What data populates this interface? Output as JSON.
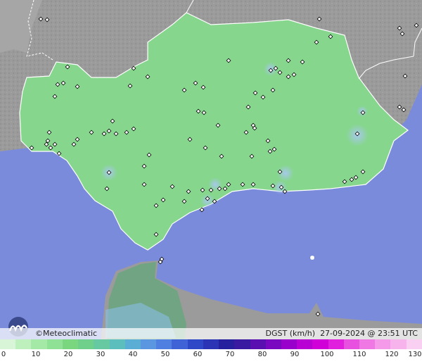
{
  "brand": {
    "copyright": "©",
    "name": "Meteoclimatic"
  },
  "info": {
    "variable": "DGST (km/h)",
    "datetime": "27-09-2024 @ 23:51 UTC"
  },
  "legend": {
    "ticks": [
      "0",
      "10",
      "20",
      "30",
      "40",
      "50",
      "60",
      "70",
      "80",
      "90",
      "100",
      "110",
      "120",
      "130"
    ]
  },
  "colors": {
    "sea": "#7b8bdc",
    "land_outside": "#9a9a9a",
    "land_region": "#86d68d",
    "gust_spot": "#9ec6e8",
    "africa": "#6aa67e"
  }
}
